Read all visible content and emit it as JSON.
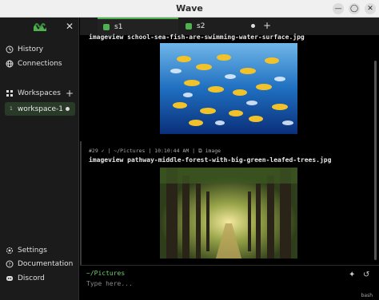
{
  "window": {
    "title": "Wave"
  },
  "sidebar": {
    "items_top": [
      {
        "label": "History",
        "icon": "history-icon"
      },
      {
        "label": "Connections",
        "icon": "globe-icon"
      }
    ],
    "workspaces_label": "Workspaces",
    "active_workspace": {
      "number": "1",
      "label": "workspace-1"
    },
    "items_bottom": [
      {
        "label": "Settings",
        "icon": "gear-icon"
      },
      {
        "label": "Documentation",
        "icon": "help-icon"
      },
      {
        "label": "Discord",
        "icon": "discord-icon"
      }
    ]
  },
  "tabs": [
    {
      "label": "s1",
      "active": true
    },
    {
      "label": "s2",
      "active": false
    }
  ],
  "blocks": [
    {
      "command": "imageview school-sea-fish-are-swimming-water-surface.jpg"
    },
    {
      "meta": "#29 ✓ | ~/Pictures | 10:10:44 AM | ⧉ image",
      "command": "imageview pathway-middle-forest-with-big-green-leafed-trees.jpg"
    }
  ],
  "prompt": {
    "cwd": "~/Pictures",
    "placeholder": "Type here...",
    "shell": "bash"
  },
  "colors": {
    "accent": "#4fb04f",
    "background": "#000000",
    "sidebar": "#1b1b1b"
  }
}
